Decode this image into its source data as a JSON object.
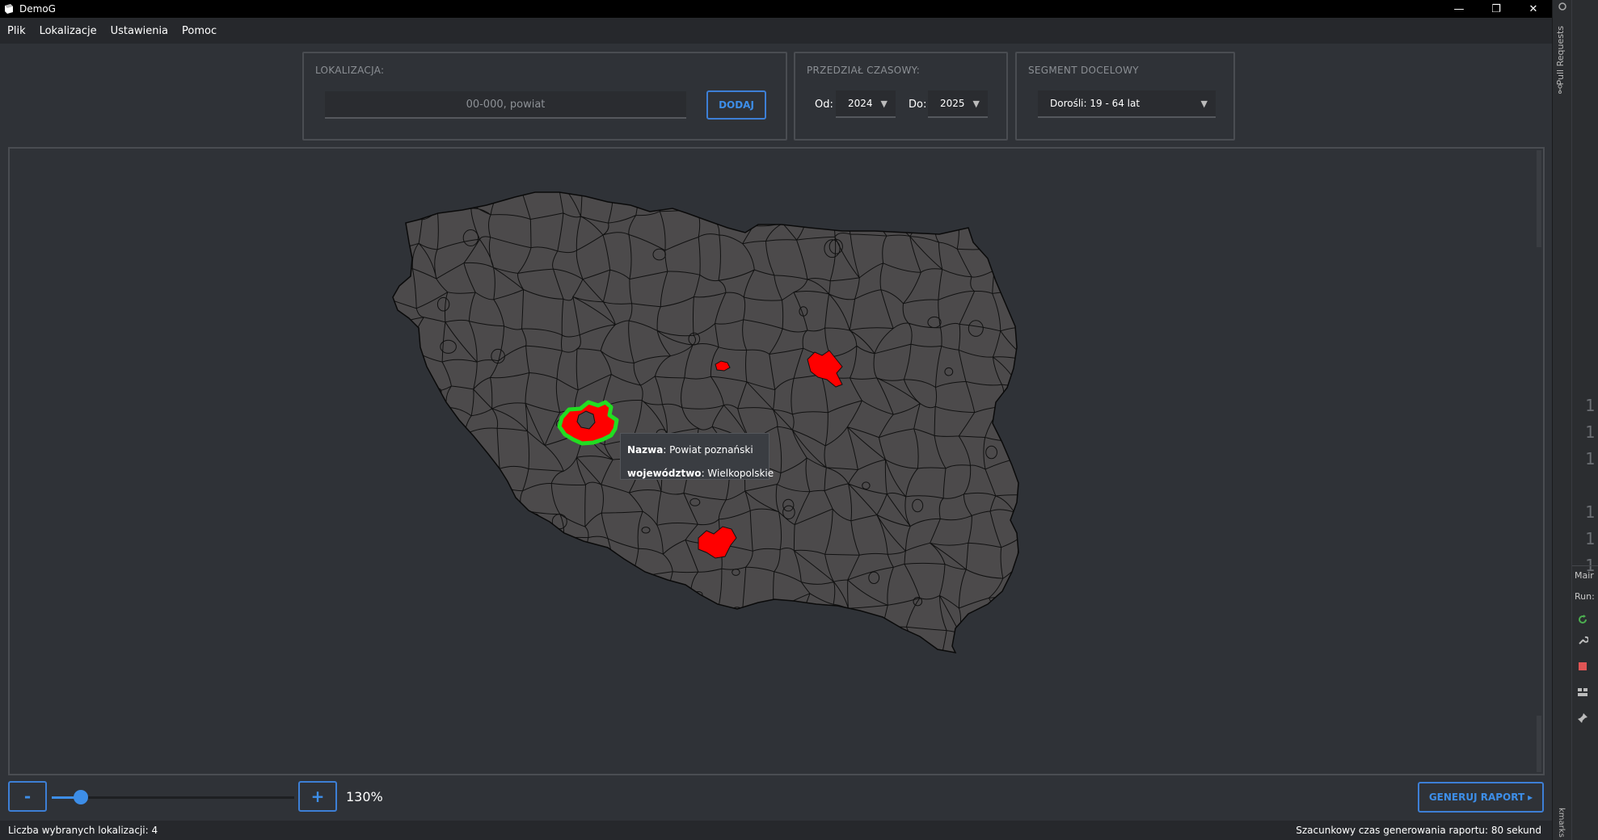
{
  "window": {
    "title": "DemoG",
    "controls": [
      "—",
      "❐",
      "✕"
    ]
  },
  "menu": {
    "items": [
      "Plik",
      "Lokalizacje",
      "Ustawienia",
      "Pomoc"
    ]
  },
  "location_panel": {
    "label": "LOKALIZACJA:",
    "input_placeholder": "00-000, powiat",
    "input_value": "",
    "add_label": "DODAJ"
  },
  "time_panel": {
    "label": "PRZEDZIAŁ CZASOWY:",
    "from_label": "Od:",
    "from_value": "2024",
    "to_label": "Do:",
    "to_value": "2025"
  },
  "segment_panel": {
    "label": "SEGMENT DOCELOWY",
    "value": "Dorośli: 19 - 64 lat"
  },
  "map": {
    "fill_color": "#4c4a4b",
    "border_color": "#111111",
    "selected_color": "#ff0000",
    "hover_outline_color": "#22dd22",
    "selected_count": 4
  },
  "tooltip": {
    "name_key": "Nazwa",
    "name_value": ": Powiat poznański",
    "region_key": "województwo",
    "region_value": ": Wielkopolskie"
  },
  "zoom": {
    "minus_label": "-",
    "plus_label": "+",
    "value_text": "130%",
    "slider_fraction": 0.12
  },
  "report_button": {
    "label": "GENERUJ RAPORT",
    "icon": "▸"
  },
  "status": {
    "left": "Liczba wybranych lokalizacji: 4",
    "right": "Szacunkowy czas generowania raportu: 80 sekund"
  },
  "ide": {
    "pull_requests_label": "Pull Requests",
    "bookmarks_label": "kmarks",
    "gutter_numbers": [
      "1",
      "1",
      "1",
      "1",
      "1",
      "1"
    ],
    "tab_label": "Mair",
    "run_label": "Run:"
  },
  "colors": {
    "accent": "#3d8ee8",
    "background": "#2f3237",
    "titlebar": "#000000"
  }
}
